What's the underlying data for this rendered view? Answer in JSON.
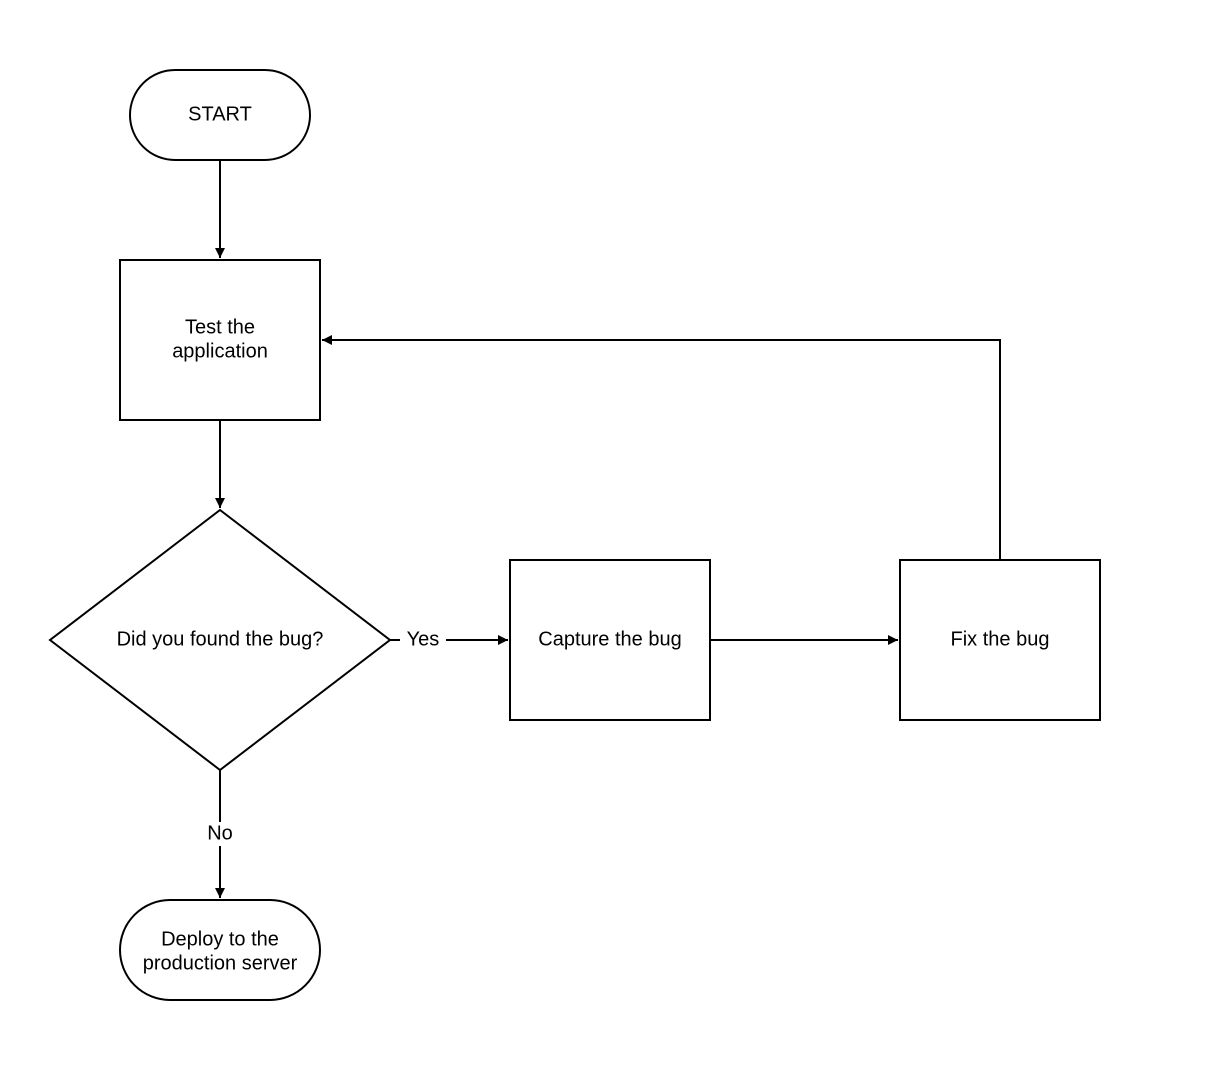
{
  "chart_data": {
    "type": "flowchart",
    "nodes": [
      {
        "id": "start",
        "shape": "terminator",
        "label": "START"
      },
      {
        "id": "test",
        "shape": "process",
        "label": "Test the application"
      },
      {
        "id": "decide",
        "shape": "decision",
        "label": "Did you found the bug?"
      },
      {
        "id": "capture",
        "shape": "process",
        "label": "Capture the bug"
      },
      {
        "id": "fix",
        "shape": "process",
        "label": "Fix the bug"
      },
      {
        "id": "deploy",
        "shape": "terminator",
        "label": "Deploy to the production server"
      }
    ],
    "edges": [
      {
        "from": "start",
        "to": "test",
        "label": ""
      },
      {
        "from": "test",
        "to": "decide",
        "label": ""
      },
      {
        "from": "decide",
        "to": "capture",
        "label": "Yes"
      },
      {
        "from": "decide",
        "to": "deploy",
        "label": "No"
      },
      {
        "from": "capture",
        "to": "fix",
        "label": ""
      },
      {
        "from": "fix",
        "to": "test",
        "label": ""
      }
    ]
  },
  "nodes": {
    "start": {
      "line1": "START"
    },
    "test": {
      "line1": "Test the",
      "line2": "application"
    },
    "decide": {
      "line1": "Did you found the bug?"
    },
    "capture": {
      "line1": "Capture the bug"
    },
    "fix": {
      "line1": "Fix the bug"
    },
    "deploy": {
      "line1": "Deploy to the",
      "line2": "production server"
    }
  },
  "edges": {
    "yes": "Yes",
    "no": "No"
  }
}
